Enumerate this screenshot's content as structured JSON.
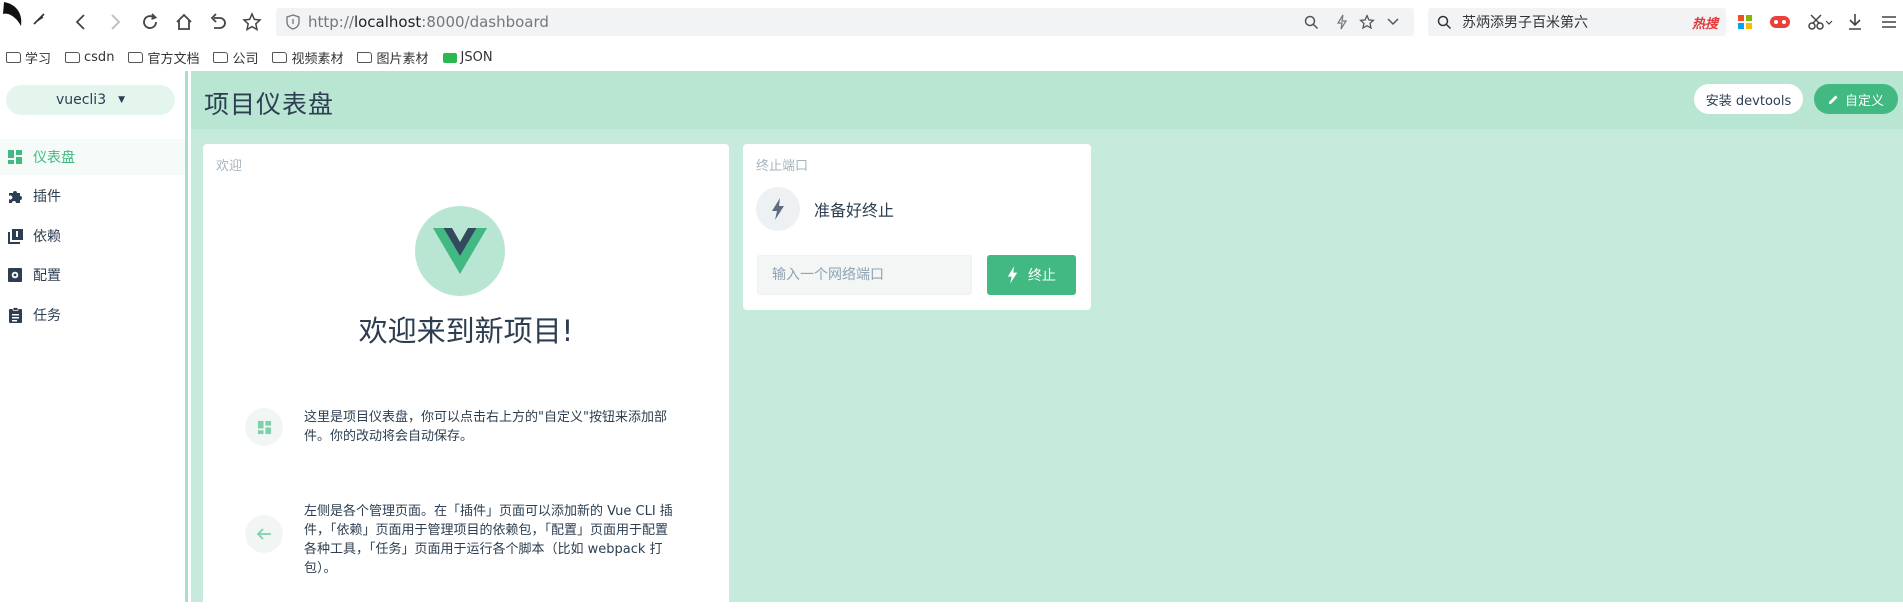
{
  "browser": {
    "url_protocol": "http://",
    "url_host": "localhost",
    "url_rest": ":8000/dashboard",
    "search_text": "苏炳添男子百米第六",
    "hot_label": "热搜"
  },
  "bookmarks": [
    {
      "label": "学习",
      "icon": "folder-icon"
    },
    {
      "label": "csdn",
      "icon": "folder-icon"
    },
    {
      "label": "官方文档",
      "icon": "folder-icon"
    },
    {
      "label": "公司",
      "icon": "folder-icon"
    },
    {
      "label": "视频素材",
      "icon": "folder-icon"
    },
    {
      "label": "图片素材",
      "icon": "folder-icon"
    },
    {
      "label": "JSON",
      "icon": "json-icon"
    }
  ],
  "sidebar": {
    "project": "vuecli3",
    "items": [
      {
        "label": "仪表盘",
        "icon": "dashboard-icon",
        "active": true
      },
      {
        "label": "插件",
        "icon": "puzzle-icon",
        "active": false
      },
      {
        "label": "依赖",
        "icon": "library-icon",
        "active": false
      },
      {
        "label": "配置",
        "icon": "settings-icon",
        "active": false
      },
      {
        "label": "任务",
        "icon": "assignment-icon",
        "active": false
      }
    ]
  },
  "header": {
    "title": "项目仪表盘",
    "devtools_label": "安装 devtools",
    "customize_label": "自定义"
  },
  "welcome": {
    "card_title": "欢迎",
    "heading": "欢迎来到新项目!",
    "tip1": "这里是项目仪表盘，你可以点击右上方的\"自定义\"按钮来添加部件。你的改动将会自动保存。",
    "tip2": "左侧是各个管理页面。在「插件」页面可以添加新的 Vue CLI 插件，「依赖」页面用于管理项目的依赖包，「配置」页面用于配置各种工具，「任务」页面用于运行各个脚本（比如 webpack 打包）。"
  },
  "kill_port": {
    "card_title": "终止端口",
    "status": "准备好终止",
    "input_placeholder": "输入一个网络端口",
    "input_value": "",
    "button_label": "终止"
  },
  "colors": {
    "accent": "#42b983",
    "header_bg": "#b8e6d3",
    "main_bg": "#c6ebdd"
  }
}
